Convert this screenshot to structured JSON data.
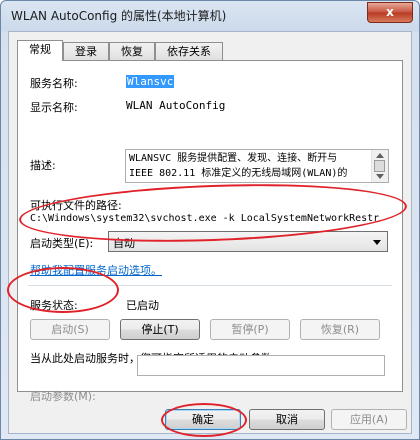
{
  "window": {
    "title": "WLAN AutoConfig 的属性(本地计算机)",
    "close_label": "x"
  },
  "tabs": [
    {
      "label": "常规",
      "active": true
    },
    {
      "label": "登录",
      "active": false
    },
    {
      "label": "恢复",
      "active": false
    },
    {
      "label": "依存关系",
      "active": false
    }
  ],
  "general": {
    "service_name_label": "服务名称:",
    "service_name": "Wlansvc",
    "display_name_label": "显示名称:",
    "display_name": "WLAN AutoConfig",
    "description_label": "描述:",
    "description": "WLANSVC 服务提供配置、发现、连接、断开与 IEEE 802.11 标准定义的无线局域网(WLAN)的",
    "exe_path_label": "可执行文件的路径:",
    "exe_path": "C:\\Windows\\system32\\svchost.exe -k LocalSystemNetworkRestr",
    "startup_type_label": "启动类型(E):",
    "startup_type": "自动",
    "help_link": "帮助我配置服务启动选项。",
    "status_label": "服务状态:",
    "status_value": "已启动",
    "start_btn": "启动(S)",
    "stop_btn": "停止(T)",
    "pause_btn": "暂停(P)",
    "resume_btn": "恢复(R)",
    "hint_text": "当从此处启动服务时，您可指定所适用的启动参数。",
    "start_params_label": "启动参数(M):",
    "start_params_value": ""
  },
  "footer": {
    "ok_btn": "确定",
    "cancel_btn": "取消",
    "apply_btn": "应用(A)"
  },
  "colors": {
    "annotation": "#e0232b",
    "link": "#0066cc",
    "selection": "#3399ff"
  }
}
